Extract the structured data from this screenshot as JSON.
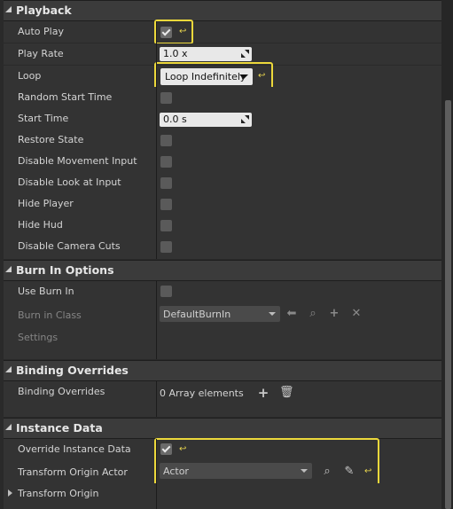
{
  "colors": {
    "highlight": "#ecd83b",
    "reset_arrow": "#e7d44e"
  },
  "playback": {
    "title": "Playback",
    "auto_play": {
      "label": "Auto Play",
      "checked": true
    },
    "play_rate": {
      "label": "Play Rate",
      "value": "1.0 x"
    },
    "loop": {
      "label": "Loop",
      "value": "Loop Indefinitely"
    },
    "random_start_time": {
      "label": "Random Start Time",
      "checked": false
    },
    "start_time": {
      "label": "Start Time",
      "value": "0.0 s"
    },
    "restore_state": {
      "label": "Restore State",
      "checked": false
    },
    "disable_movement_input": {
      "label": "Disable Movement Input",
      "checked": false
    },
    "disable_look_at_input": {
      "label": "Disable Look at Input",
      "checked": false
    },
    "hide_player": {
      "label": "Hide Player",
      "checked": false
    },
    "hide_hud": {
      "label": "Hide Hud",
      "checked": false
    },
    "disable_camera_cuts": {
      "label": "Disable Camera Cuts",
      "checked": false
    }
  },
  "burn_in": {
    "title": "Burn In Options",
    "use_burn_in": {
      "label": "Use Burn In",
      "checked": false
    },
    "burn_in_class": {
      "label": "Burn in Class",
      "value": "DefaultBurnIn"
    },
    "settings": {
      "label": "Settings"
    }
  },
  "binding_overrides": {
    "title": "Binding Overrides",
    "row": {
      "label": "Binding Overrides",
      "value": "0 Array elements"
    }
  },
  "instance_data": {
    "title": "Instance Data",
    "override_instance_data": {
      "label": "Override Instance Data",
      "checked": true
    },
    "transform_origin_actor": {
      "label": "Transform Origin Actor",
      "value": "Actor"
    },
    "transform_origin": {
      "label": "Transform Origin"
    }
  }
}
